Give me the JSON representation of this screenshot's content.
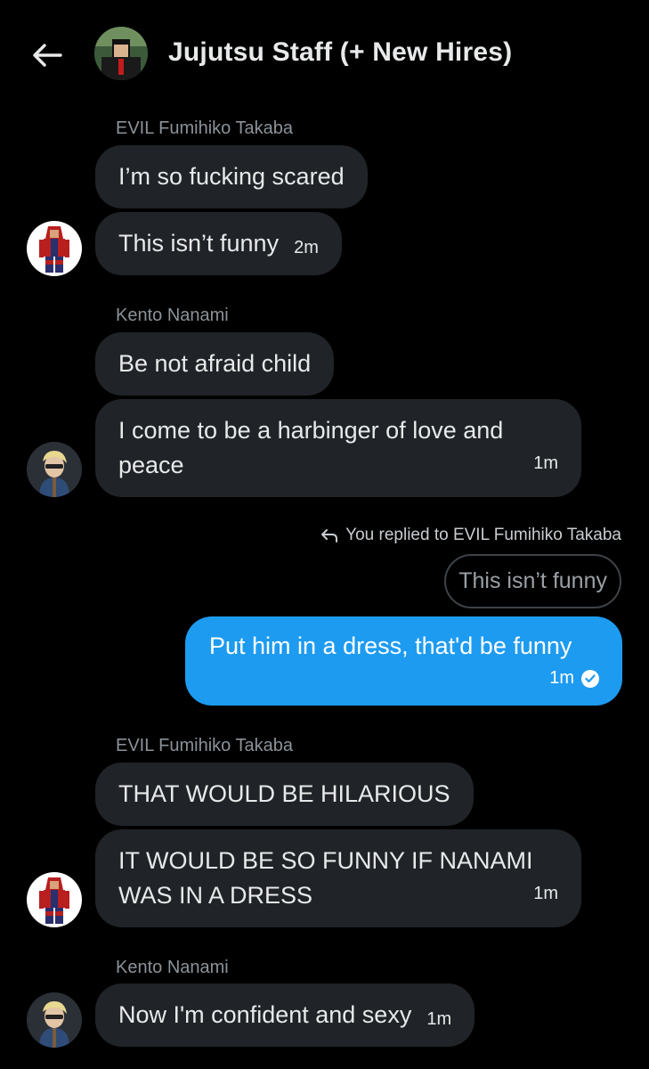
{
  "header": {
    "title": "Jujutsu Staff (+ New Hires)",
    "back_icon": "arrow-left-icon"
  },
  "conversation": {
    "reply_context": {
      "label": "You replied to EVIL Fumihiko Takaba",
      "quoted_text": "This isn’t funny"
    },
    "own_message": {
      "text": "Put him in a dress, that'd be funny",
      "time": "1m",
      "status_icon": "check-circle-icon"
    },
    "groups": [
      {
        "sender": "EVIL Fumihiko Takaba",
        "messages": [
          {
            "lines": [
              "I’m so fucking scared"
            ],
            "time": ""
          },
          {
            "lines": [
              "This isn’t funny"
            ],
            "time": "2m"
          }
        ]
      },
      {
        "sender": "Kento Nanami",
        "messages": [
          {
            "lines": [
              "Be not afraid child"
            ],
            "time": ""
          },
          {
            "lines": [
              "I come to be a harbinger of love and",
              "peace"
            ],
            "time": "1m"
          }
        ]
      },
      {
        "sender": "EVIL Fumihiko Takaba",
        "messages": [
          {
            "lines": [
              "THAT WOULD BE HILARIOUS"
            ],
            "time": ""
          },
          {
            "lines": [
              "IT WOULD BE SO FUNNY IF NANAMI",
              "WAS IN A DRESS"
            ],
            "time": "1m"
          }
        ]
      },
      {
        "sender": "Kento Nanami",
        "messages": [
          {
            "lines": [
              "Now I'm confident and sexy"
            ],
            "time": "1m"
          }
        ]
      }
    ]
  },
  "colors": {
    "background": "#000000",
    "incoming_bubble": "#202327",
    "outgoing_bubble": "#1d9bf0",
    "secondary_text": "#8b9299"
  }
}
